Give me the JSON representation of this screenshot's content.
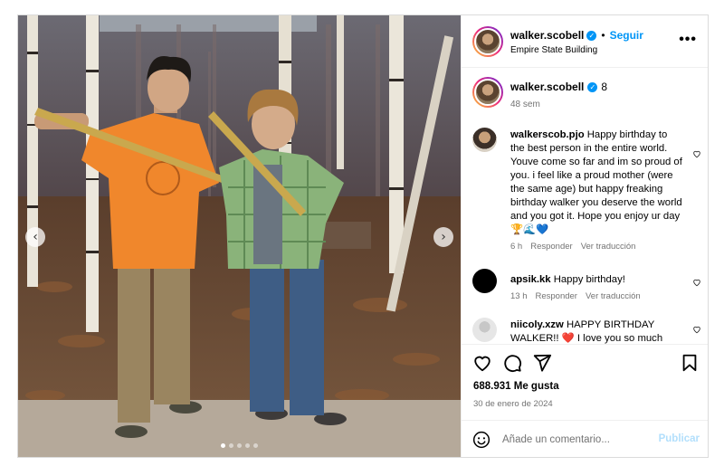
{
  "post": {
    "photo_alt": "Two smiling boys holding swords in a birch forest film set",
    "carousel": {
      "prev": "‹",
      "next": "›",
      "dot_count": 5,
      "active_dot": 1
    }
  },
  "header": {
    "username": "walker.scobell",
    "separator": "•",
    "follow_label": "Seguir",
    "location": "Empire State Building",
    "more_icon": "more-icon",
    "more_glyph": "•••"
  },
  "caption": {
    "username": "walker.scobell",
    "text": "8",
    "time": "48 sem"
  },
  "comments": [
    {
      "username": "walkerscob.pjo",
      "text": "Happy birthday to the best person in the entire world. Youve come so far and im so proud of you. i feel like a proud mother (were the same age) but happy freaking birthday walker you deserve the world and you got it. Hope you enjoy ur day 🏆🌊💙",
      "time": "6 h",
      "reply": "Responder",
      "translate": "Ver traducción"
    },
    {
      "username": "apsik.kk",
      "text": "Happy birthday!",
      "time": "13 h",
      "reply": "Responder",
      "translate": "Ver traducción"
    },
    {
      "username": "niicoly.xzw",
      "text": "HAPPY BIRTHDAY WALKER!! ❤️ I love you so much"
    }
  ],
  "actions": {
    "like_icon": "heart-icon",
    "comment_icon": "comment-icon",
    "share_icon": "share-icon",
    "save_icon": "bookmark-icon"
  },
  "likes": "688.931 Me gusta",
  "date": "30 de enero de 2024",
  "add_comment": {
    "placeholder": "Añade un comentario...",
    "post_label": "Publicar",
    "emoji_icon": "emoji-icon"
  },
  "colors": {
    "accent": "#0095f6",
    "post_disabled": "#b2dffc",
    "heart_red": "#ed4956",
    "muted": "#737373"
  }
}
